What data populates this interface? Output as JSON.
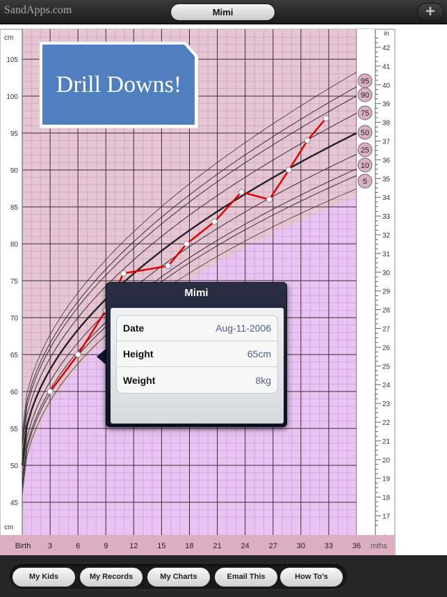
{
  "header": {
    "brand": "SandApps.com",
    "child_name": "Mimi",
    "add_label": "+"
  },
  "callout": {
    "text": "Drill Downs!"
  },
  "chart_data": {
    "type": "line",
    "ylabel_left": "cm",
    "ylabel_right": "in",
    "xlabel": "mths",
    "ylim_cm": [
      43,
      108
    ],
    "yticks_cm": [
      45,
      50,
      55,
      60,
      65,
      70,
      75,
      80,
      85,
      90,
      95,
      100,
      105
    ],
    "yticks_in": [
      17,
      18,
      19,
      20,
      21,
      22,
      23,
      24,
      25,
      26,
      27,
      28,
      29,
      30,
      31,
      32,
      33,
      34,
      35,
      36,
      37,
      38,
      39,
      40,
      41,
      42
    ],
    "xlim": [
      0,
      36
    ],
    "xticks": [
      {
        "v": 0,
        "label": "Birth"
      },
      {
        "v": 3,
        "label": "3"
      },
      {
        "v": 6,
        "label": "6"
      },
      {
        "v": 9,
        "label": "9"
      },
      {
        "v": 12,
        "label": "12"
      },
      {
        "v": 15,
        "label": "15"
      },
      {
        "v": 18,
        "label": "18"
      },
      {
        "v": 21,
        "label": "21"
      },
      {
        "v": 24,
        "label": "24"
      },
      {
        "v": 27,
        "label": "27"
      },
      {
        "v": 30,
        "label": "30"
      },
      {
        "v": 33,
        "label": "33"
      },
      {
        "v": 36,
        "label": "36"
      }
    ],
    "percentiles": [
      "95",
      "90",
      "75",
      "50",
      "25",
      "10",
      "5"
    ],
    "series": [
      {
        "values": [
          [
            3,
            60
          ],
          [
            6,
            65
          ],
          [
            9,
            71
          ],
          [
            10.9,
            76
          ],
          [
            15.7,
            77
          ],
          [
            17.7,
            80
          ],
          [
            20.7,
            83
          ],
          [
            23.6,
            87
          ],
          [
            26.6,
            86
          ],
          [
            28.7,
            90
          ],
          [
            30.7,
            94
          ],
          [
            32.7,
            97
          ]
        ]
      }
    ],
    "colors": {
      "record_line": "#e00000",
      "median": "#111111",
      "bg_upper": "#e6c6d3",
      "bg_lower": "#e8c3f4",
      "axis_band": "#dcafc0"
    }
  },
  "popup": {
    "title": "Mimi",
    "rows": [
      {
        "label": "Date",
        "value": "Aug-11-2006"
      },
      {
        "label": "Height",
        "value": "65cm"
      },
      {
        "label": "Weight",
        "value": "8kg"
      }
    ]
  },
  "toolbar": {
    "buttons": [
      "My Kids",
      "My Records",
      "My Charts",
      "Email This",
      "How To's"
    ]
  }
}
